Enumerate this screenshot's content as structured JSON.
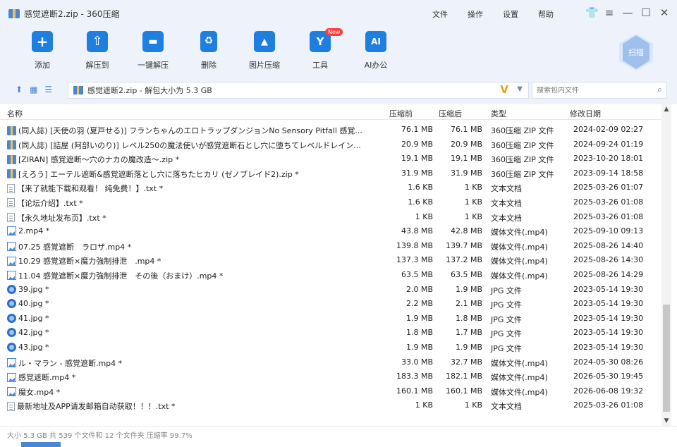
{
  "window": {
    "title": "感觉遮断2.zip - 360压缩",
    "menu": [
      "文件",
      "操作",
      "设置",
      "帮助"
    ],
    "controls": [
      "👕",
      "≡",
      "—",
      "☐",
      "✕"
    ]
  },
  "toolbar": {
    "buttons": [
      {
        "label": "添加",
        "icon": "add-icon"
      },
      {
        "label": "解压到",
        "icon": "extract-icon"
      },
      {
        "label": "一键解压",
        "icon": "one-click-extract-icon"
      },
      {
        "label": "删除",
        "icon": "delete-icon"
      },
      {
        "label": "图片压缩",
        "icon": "image-compress-icon"
      },
      {
        "label": "工具",
        "icon": "tools-icon",
        "badge": "New"
      },
      {
        "label": "AI办公",
        "icon": "ai-icon"
      }
    ],
    "scan_label": "扫描"
  },
  "address": {
    "path": "感觉遮断2.zip - 解包大小为 5.3 GB",
    "search_placeholder": "搜索包内文件"
  },
  "table": {
    "headers": {
      "name": "名称",
      "original": "压缩前",
      "compressed": "压缩后",
      "type": "类型",
      "date": "修改日期"
    },
    "rows": [
      {
        "icon": "zip",
        "name": "(同人誌) [天使の羽 (夏戸せる)] フランちゃんのエロトラップダンジョンNo Sensory Pitfall 感覚...",
        "original": "76.1 MB",
        "compressed": "76.1 MB",
        "type": "360压缩 ZIP 文件",
        "date": "2024-02-09 02:27"
      },
      {
        "icon": "zip",
        "name": "(同人誌) [詰屋 (阿部いのり)] レベル250の魔法使いが感覚遮断石とし穴に堕ちてレベルドレイン...",
        "original": "20.9 MB",
        "compressed": "20.9 MB",
        "type": "360压缩 ZIP 文件",
        "date": "2024-09-24 01:19"
      },
      {
        "icon": "zip",
        "name": "[ZIRAN] 感覚遮断～穴のナカの魔改造～.zip *",
        "original": "19.1 MB",
        "compressed": "19.1 MB",
        "type": "360压缩 ZIP 文件",
        "date": "2023-10-20 18:01"
      },
      {
        "icon": "zip",
        "name": "[えろう] エーテル遮断&感覚遮断落とし穴に落ちたヒカリ (ゼノブレイド2).zip *",
        "original": "31.9 MB",
        "compressed": "31.9 MB",
        "type": "360压缩 ZIP 文件",
        "date": "2023-09-14 18:58"
      },
      {
        "icon": "txt",
        "name": "【来了就能下载和观看！ 纯免费！】.txt *",
        "original": "1.6 KB",
        "compressed": "1 KB",
        "type": "文本文档",
        "date": "2025-03-26 01:07"
      },
      {
        "icon": "txt",
        "name": "【论坛介绍】.txt *",
        "original": "1.6 KB",
        "compressed": "1 KB",
        "type": "文本文档",
        "date": "2025-03-26 01:08"
      },
      {
        "icon": "txt",
        "name": "【永久地址发布页】.txt *",
        "original": "1 KB",
        "compressed": "1 KB",
        "type": "文本文档",
        "date": "2025-03-26 01:08"
      },
      {
        "icon": "vid",
        "name": "2.mp4 *",
        "original": "43.8 MB",
        "compressed": "42.8 MB",
        "type": "媒体文件(.mp4)",
        "date": "2025-09-10 09:13"
      },
      {
        "icon": "vid",
        "name": "07.25 感覚遮断　ラロザ.mp4 *",
        "original": "139.8 MB",
        "compressed": "139.7 MB",
        "type": "媒体文件(.mp4)",
        "date": "2025-08-26 14:40"
      },
      {
        "icon": "vid",
        "name": "10.29 感覚遮断×魔力強制排泄　.mp4 *",
        "original": "137.3 MB",
        "compressed": "137.2 MB",
        "type": "媒体文件(.mp4)",
        "date": "2025-08-26 14:30"
      },
      {
        "icon": "vid",
        "name": "11.04 感覚遮断×魔力強制排泄　その後（おまけ）.mp4 *",
        "original": "63.5 MB",
        "compressed": "63.5 MB",
        "type": "媒体文件(.mp4)",
        "date": "2025-08-26 14:29"
      },
      {
        "icon": "img",
        "name": "39.jpg *",
        "original": "2.0 MB",
        "compressed": "1.9 MB",
        "type": "JPG 文件",
        "date": "2023-05-14 19:30"
      },
      {
        "icon": "img",
        "name": "40.jpg *",
        "original": "2.2 MB",
        "compressed": "2.1 MB",
        "type": "JPG 文件",
        "date": "2023-05-14 19:30"
      },
      {
        "icon": "img",
        "name": "41.jpg *",
        "original": "1.9 MB",
        "compressed": "1.8 MB",
        "type": "JPG 文件",
        "date": "2023-05-14 19:30"
      },
      {
        "icon": "img",
        "name": "42.jpg *",
        "original": "1.8 MB",
        "compressed": "1.7 MB",
        "type": "JPG 文件",
        "date": "2023-05-14 19:30"
      },
      {
        "icon": "img",
        "name": "43.jpg *",
        "original": "1.9 MB",
        "compressed": "1.9 MB",
        "type": "JPG 文件",
        "date": "2023-05-14 19:30"
      },
      {
        "icon": "vid",
        "name": "ル・マラン - 感覚遮断.mp4 *",
        "original": "33.0 MB",
        "compressed": "32.7 MB",
        "type": "媒体文件(.mp4)",
        "date": "2024-05-30 08:26"
      },
      {
        "icon": "vid",
        "name": "感覚遮断.mp4 *",
        "original": "183.3 MB",
        "compressed": "182.1 MB",
        "type": "媒体文件(.mp4)",
        "date": "2026-05-30 19:45"
      },
      {
        "icon": "vid",
        "name": "魔女.mp4 *",
        "original": "160.1 MB",
        "compressed": "160.1 MB",
        "type": "媒体文件(.mp4)",
        "date": "2026-06-08 19:32"
      },
      {
        "icon": "txt",
        "name": "最新地址及APP请发邮箱自动获取！！！.txt *",
        "original": "1 KB",
        "compressed": "1 KB",
        "type": "文本文档",
        "date": "2025-03-26 01:08"
      }
    ]
  },
  "status": {
    "text": "大小 5.3 GB 共 539 个文件和 12 个文件夹 压缩率 99.7%"
  }
}
